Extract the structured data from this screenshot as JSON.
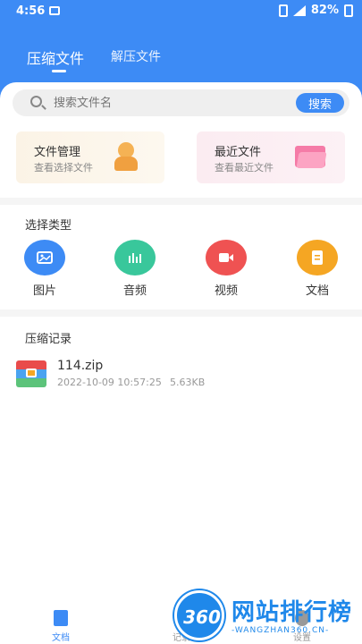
{
  "status_bar": {
    "time": "4:56",
    "battery": "82%"
  },
  "tabs": [
    {
      "label": "压缩文件",
      "active": true
    },
    {
      "label": "解压文件",
      "active": false
    }
  ],
  "search": {
    "placeholder": "搜索文件名",
    "button_label": "搜索"
  },
  "quick_cards": [
    {
      "title": "文件管理",
      "subtitle": "查看选择文件",
      "icon": "person-icon"
    },
    {
      "title": "最近文件",
      "subtitle": "查看最近文件",
      "icon": "folder-icon"
    }
  ],
  "type_section": {
    "title": "选择类型",
    "items": [
      {
        "label": "图片",
        "icon": "image-icon",
        "color": "#3d8bf5"
      },
      {
        "label": "音频",
        "icon": "audio-icon",
        "color": "#39c79b"
      },
      {
        "label": "视频",
        "icon": "video-icon",
        "color": "#ef5252"
      },
      {
        "label": "文档",
        "icon": "document-icon",
        "color": "#f5a623"
      }
    ]
  },
  "records_section": {
    "title": "压缩记录",
    "items": [
      {
        "name": "114.zip",
        "date": "2022-10-09 10:57:25",
        "size": "5.63KB",
        "icon": "zip-icon"
      }
    ]
  },
  "bottom_nav": [
    {
      "label": "文档",
      "icon": "document-icon",
      "active": true
    },
    {
      "label": "记录",
      "icon": "record-icon",
      "active": false
    },
    {
      "label": "设置",
      "icon": "settings-icon",
      "active": false
    }
  ],
  "watermark": {
    "logo_text": "360",
    "text": "网站排行榜",
    "sub": "-WANGZHAN360.CN-"
  },
  "colors": {
    "primary": "#3d8bf5",
    "watermark": "#1f88ea"
  }
}
